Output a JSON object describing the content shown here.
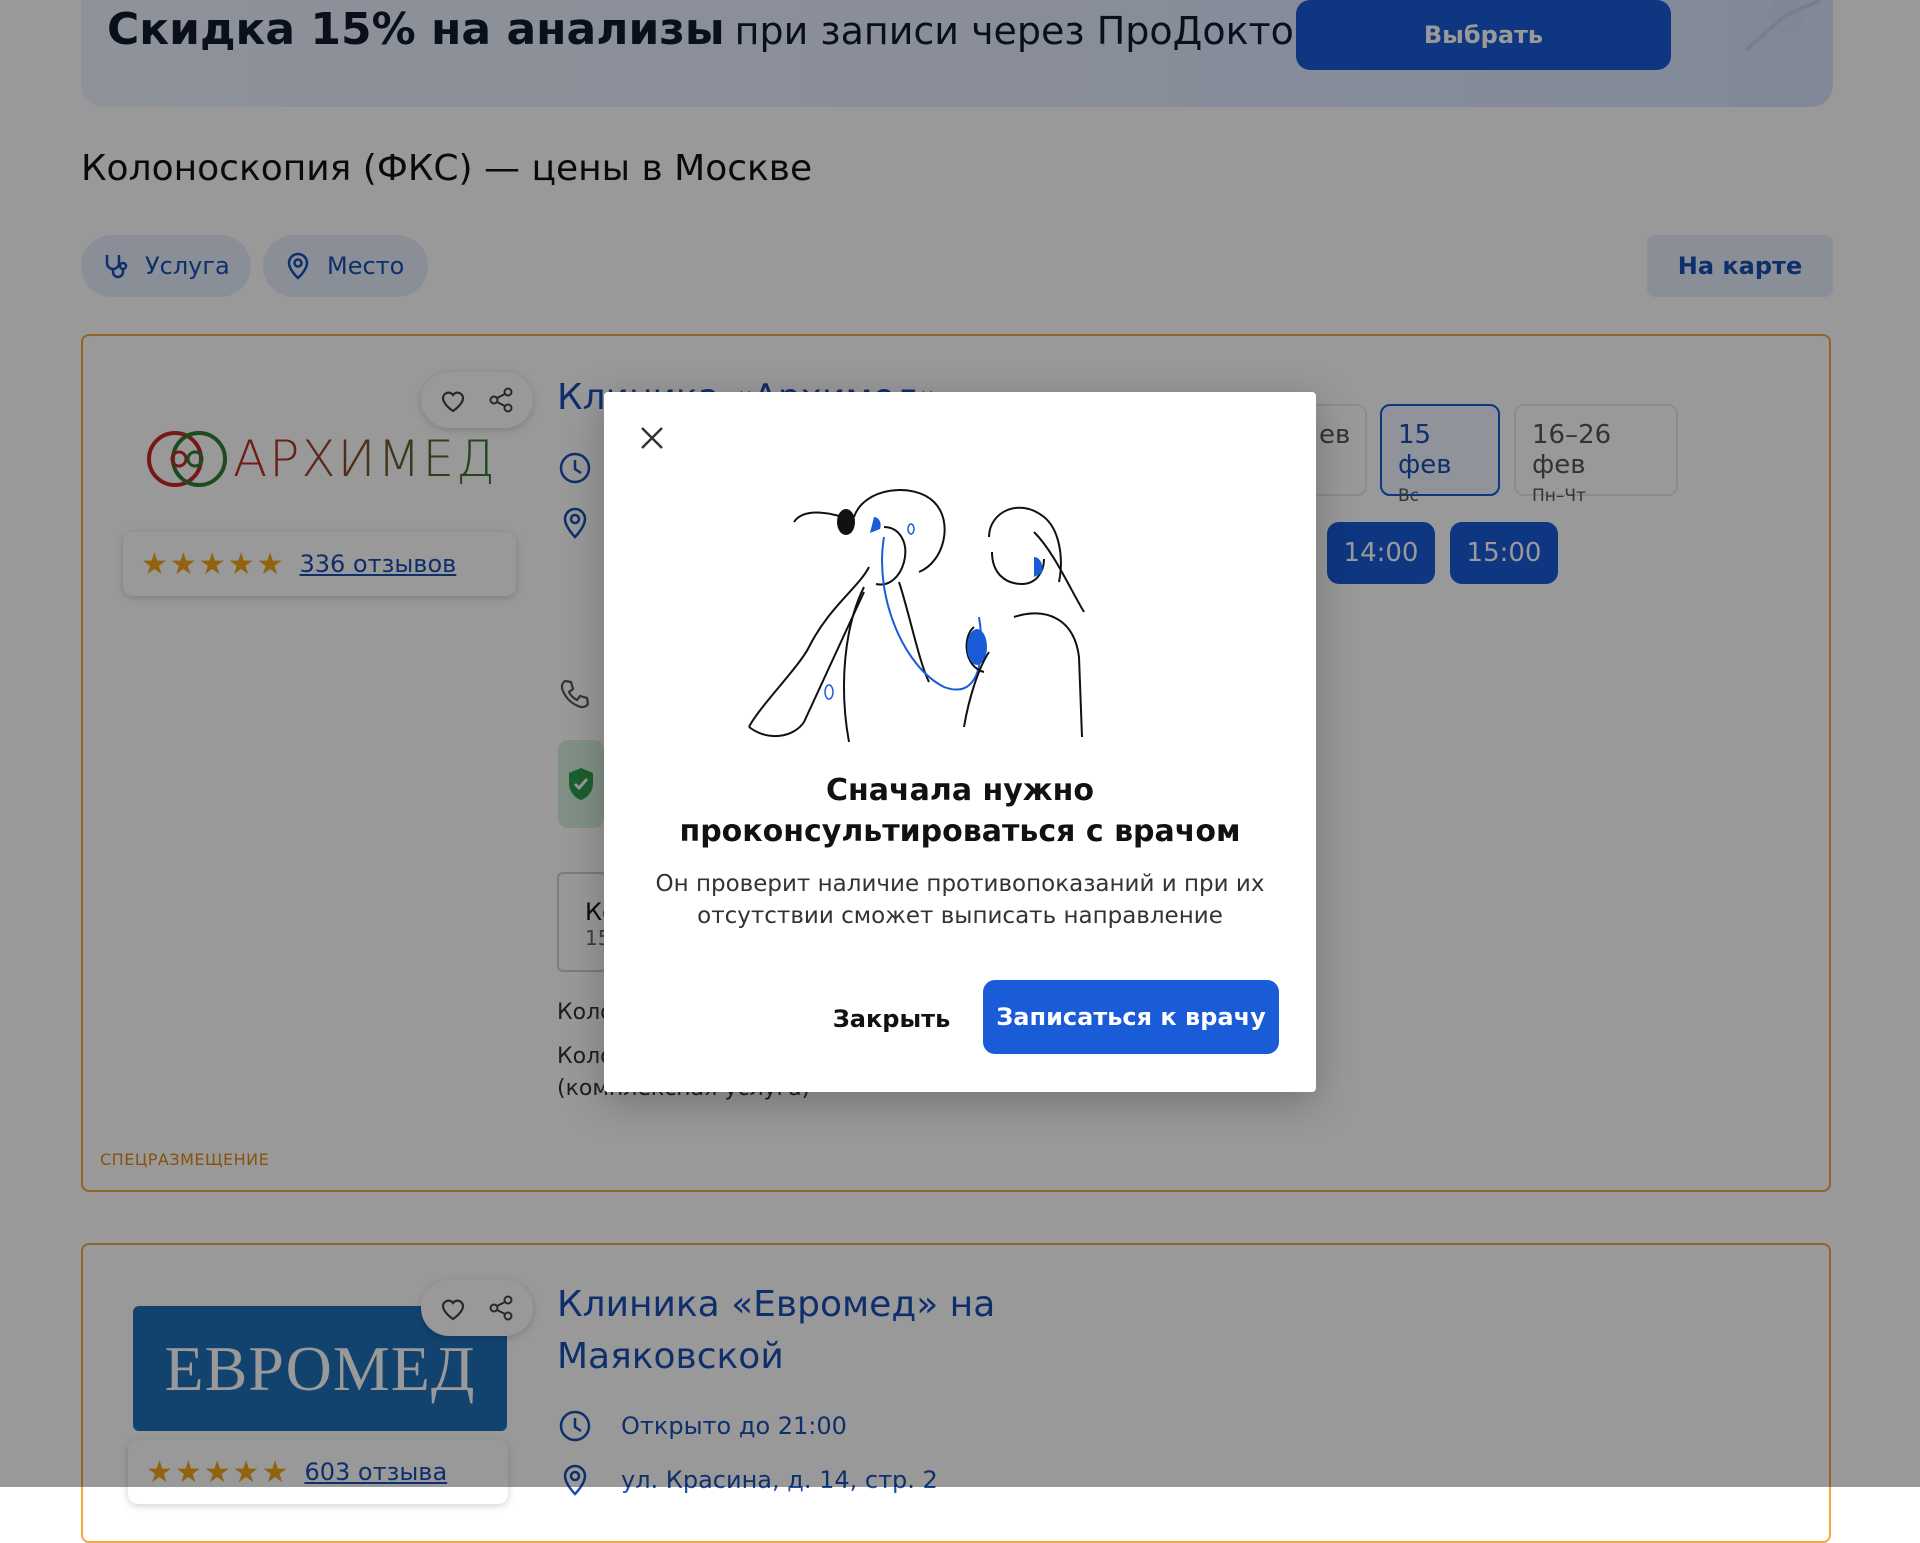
{
  "banner": {
    "title_bold": "Скидка 15% на анализы",
    "title_rest": "при записи через ПроДокторов",
    "button_label": "Выбрать"
  },
  "page": {
    "title": "Колоноскопия (ФКС) — цены в Москве"
  },
  "filters": {
    "service_label": "Услуга",
    "place_label": "Место",
    "map_label": "На карте"
  },
  "clinic1": {
    "name_partial": "Клиника «Архимед»",
    "logo_text": "АРХИМЕД",
    "reviews": "336 отзывов",
    "rating": 4.5,
    "dates": [
      {
        "main": "ев",
        "sub": ""
      },
      {
        "main": "15 фев",
        "sub": "Вс"
      },
      {
        "main": "16–26 фев",
        "sub": "Пн–Чт"
      }
    ],
    "times": [
      "14:00",
      "15:00"
    ],
    "partial_tile_main": "Ко",
    "partial_tile_sub": "15",
    "partial_line1": "Коло",
    "partial_line2": "Коло",
    "partial_line3": "(комплексная услуга)",
    "special_label": "СПЕЦРАЗМЕЩЕНИЕ"
  },
  "clinic2": {
    "name": "Клиника «Евромед» на Маяковской",
    "logo_text": "ЕВРОМЕД",
    "reviews": "603 отзыва",
    "rating": 4.5,
    "hours": "Открыто до 21:00",
    "address": "ул. Красина, д. 14, стр. 2"
  },
  "modal": {
    "title": "Сначала нужно проконсультироваться с врачом",
    "text": "Он проверит наличие противопоказаний и при их отсутствии сможет выписать направление",
    "close_label": "Закрыть",
    "primary_label": "Записаться к врачу"
  },
  "colors": {
    "accent": "#1a5bd8",
    "link": "#1a4fb4",
    "card_border": "#f0a93e",
    "star": "#f2a51b"
  }
}
